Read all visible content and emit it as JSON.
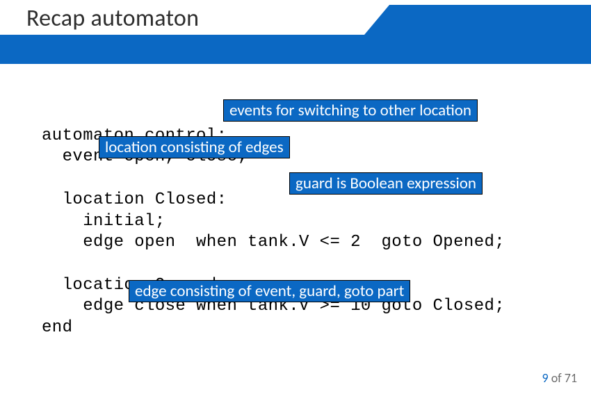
{
  "title": "Recap automaton",
  "callouts": {
    "events": "events for switching to other location",
    "location": "location consisting of edges",
    "guard": "guard is Boolean expression",
    "edge": "edge consisting of event, guard, goto part"
  },
  "code": {
    "l1": "automaton control:",
    "l2": "  event open, close;",
    "l3": "  location Closed:",
    "l4": "    initial;",
    "l5": "    edge open  when tank.V <= 2  goto Opened;",
    "l6": "  location Opened:",
    "l7": "    edge close when tank.V >= 10 goto Closed;",
    "l8": "end",
    "blank": " "
  },
  "footer": {
    "current": "9",
    "of": " of ",
    "total": "71"
  }
}
